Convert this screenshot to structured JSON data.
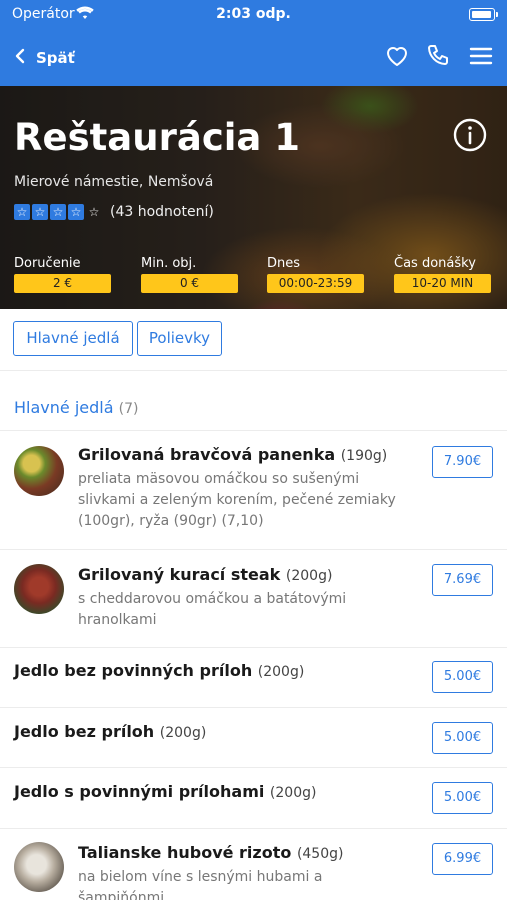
{
  "status_bar": {
    "carrier": "Operátor",
    "time": "2:03 odp."
  },
  "nav": {
    "back_label": "Späť",
    "icons": [
      "heart-icon",
      "phone-icon",
      "menu-icon"
    ]
  },
  "restaurant": {
    "name": "Reštaurácia 1",
    "address": "Mierové námestie, Nemšová",
    "rating_stars": 4,
    "rating_max": 5,
    "rating_count": "(43 hodnotení)",
    "stats": [
      {
        "label": "Doručenie",
        "value": "2 €"
      },
      {
        "label": "Min. obj.",
        "value": "0 €"
      },
      {
        "label": "Dnes",
        "value": "00:00-23:59"
      },
      {
        "label": "Čas donášky",
        "value": "10-20 MIN"
      }
    ]
  },
  "categories": [
    "Hlavné jedlá",
    "Polievky"
  ],
  "section": {
    "title": "Hlavné jedlá",
    "count": "(7)"
  },
  "items": [
    {
      "name": "Grilovaná bravčová panenka",
      "weight": "(190g)",
      "desc": "preliata mäsovou omáčkou so sušenými slivkami a zeleným korením, pečené zemiaky (100gr), ryža (90gr) (7,10)",
      "price": "7.90€"
    },
    {
      "name": "Grilovaný kurací steak",
      "weight": "(200g)",
      "desc": "s cheddarovou omáčkou a batátovými hranolkami",
      "price": "7.69€"
    },
    {
      "name": "Jedlo bez povinných príloh",
      "weight": "(200g)",
      "desc": "",
      "price": "5.00€"
    },
    {
      "name": "Jedlo bez príloh",
      "weight": "(200g)",
      "desc": "",
      "price": "5.00€"
    },
    {
      "name": "Jedlo s povinnými prílohami",
      "weight": "(200g)",
      "desc": "",
      "price": "5.00€"
    },
    {
      "name": "Talianske hubové rizoto",
      "weight": "(450g)",
      "desc": "na bielom víne s lesnými hubami a šampiňónmi",
      "price": "6.99€"
    }
  ],
  "colors": {
    "primary": "#2f7be0",
    "badge": "#ffc61a"
  }
}
